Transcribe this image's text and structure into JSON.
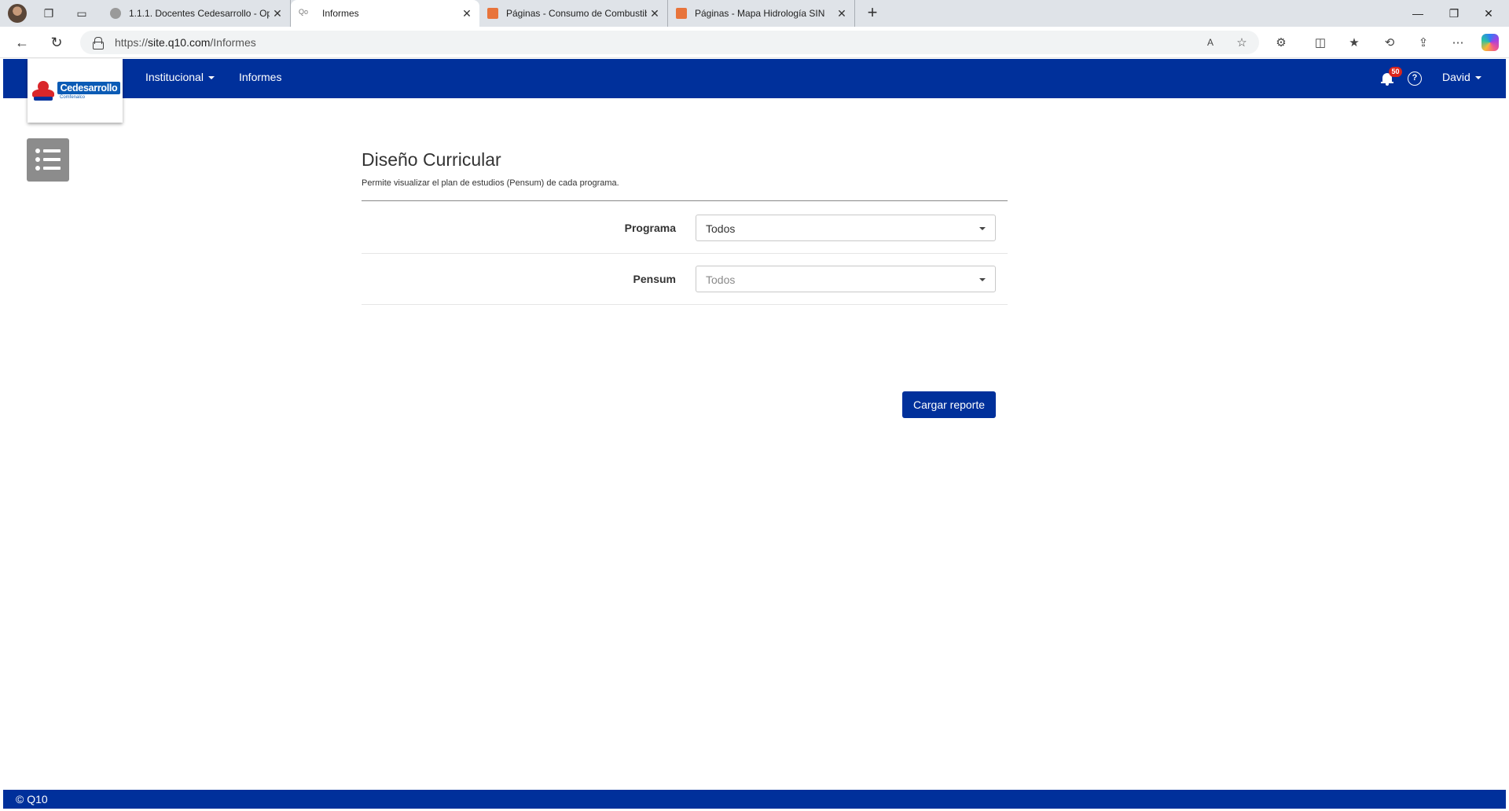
{
  "browser": {
    "tabs": [
      {
        "title": "1.1.1. Docentes Cedesarrollo - Op",
        "active": false
      },
      {
        "title": "Informes",
        "active": true,
        "favicon_text": "Qo"
      },
      {
        "title": "Páginas - Consumo de Combustib",
        "active": false
      },
      {
        "title": "Páginas - Mapa Hidrología SIN",
        "active": false
      }
    ],
    "url_scheme": "https://",
    "url_host": "site.q10.com",
    "url_path": "/Informes",
    "window_controls": {
      "minimize": "—",
      "restore": "❐",
      "close": "✕"
    }
  },
  "navbar": {
    "logo_text": "Cedesarrollo",
    "logo_subtext": "Comfenalco",
    "menu": [
      {
        "label": "Institucional",
        "has_dropdown": true
      },
      {
        "label": "Informes",
        "has_dropdown": false
      }
    ],
    "notification_count": "50",
    "help_label": "?",
    "user_name": "David"
  },
  "page": {
    "title": "Diseño Curricular",
    "description": "Permite visualizar el plan de estudios (Pensum) de cada programa.",
    "fields": [
      {
        "label": "Programa",
        "value": "Todos",
        "disabled": false
      },
      {
        "label": "Pensum",
        "value": "Todos",
        "disabled": true
      }
    ],
    "submit_label": "Cargar reporte"
  },
  "footer": {
    "text": "© Q10"
  },
  "colors": {
    "brand_blue": "#00309b",
    "menu_button_gray": "#8c8c8c",
    "badge_red": "#d9251c"
  }
}
